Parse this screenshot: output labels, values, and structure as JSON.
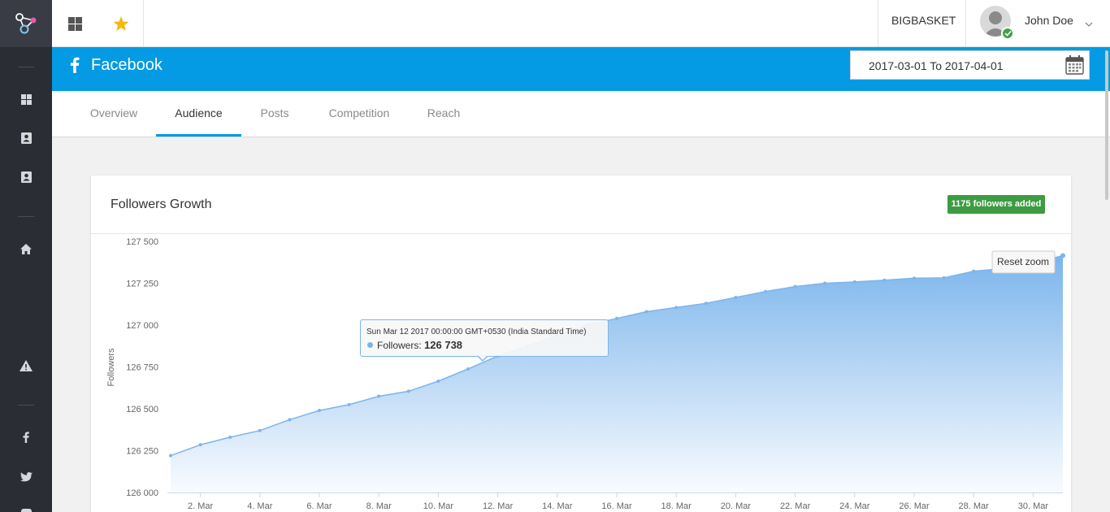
{
  "sidebar": {
    "icons": [
      "logo-icon",
      "dashboard-icon",
      "contact-card-icon",
      "contact-card-icon",
      "home-icon",
      "alert-icon",
      "facebook-icon",
      "twitter-icon"
    ]
  },
  "topbar": {
    "brand": "BIGBASKET",
    "user_name": "John Doe"
  },
  "header": {
    "title": "Facebook",
    "date_range": "2017-03-01 To 2017-04-01"
  },
  "tabs": [
    {
      "label": "Overview",
      "active": false
    },
    {
      "label": "Audience",
      "active": true
    },
    {
      "label": "Posts",
      "active": false
    },
    {
      "label": "Competition",
      "active": false
    },
    {
      "label": "Reach",
      "active": false
    }
  ],
  "card": {
    "title": "Followers Growth",
    "badge": "1175 followers added",
    "reset_zoom": "Reset zoom"
  },
  "tooltip": {
    "date": "Sun Mar 12 2017 00:00:00 GMT+0530 (India Standard Time)",
    "series": "Followers",
    "value": "126 738"
  },
  "colors": {
    "accent": "#049ae4",
    "series": "#7cb5ec",
    "badge": "#3d9b42",
    "sidebar": "#2b2d35"
  },
  "chart_data": {
    "type": "area",
    "ylabel": "Followers",
    "ylim": [
      126000,
      127500
    ],
    "yticks": [
      "127 500",
      "127 250",
      "127 000",
      "126 750",
      "126 500",
      "126 250",
      "126 000"
    ],
    "xticks": [
      "2. Mar",
      "4. Mar",
      "6. Mar",
      "8. Mar",
      "10. Mar",
      "12. Mar",
      "14. Mar",
      "16. Mar",
      "18. Mar",
      "20. Mar",
      "22. Mar",
      "24. Mar",
      "26. Mar",
      "28. Mar",
      "30. Mar"
    ],
    "series": [
      {
        "name": "Followers",
        "x": [
          "2017-03-01",
          "2017-03-02",
          "2017-03-03",
          "2017-03-04",
          "2017-03-05",
          "2017-03-06",
          "2017-03-07",
          "2017-03-08",
          "2017-03-09",
          "2017-03-10",
          "2017-03-11",
          "2017-03-12",
          "2017-03-13",
          "2017-03-14",
          "2017-03-15",
          "2017-03-16",
          "2017-03-17",
          "2017-03-18",
          "2017-03-19",
          "2017-03-20",
          "2017-03-21",
          "2017-03-22",
          "2017-03-23",
          "2017-03-24",
          "2017-03-25",
          "2017-03-26",
          "2017-03-27",
          "2017-03-28",
          "2017-03-29",
          "2017-03-30",
          "2017-03-31"
        ],
        "values": [
          126220,
          126285,
          126330,
          126370,
          126435,
          126490,
          126525,
          126575,
          126605,
          126665,
          126738,
          126815,
          126875,
          126940,
          127000,
          127040,
          127080,
          127105,
          127130,
          127165,
          127200,
          127230,
          127250,
          127258,
          127268,
          127280,
          127282,
          127322,
          127338,
          127370,
          127415
        ]
      }
    ]
  }
}
